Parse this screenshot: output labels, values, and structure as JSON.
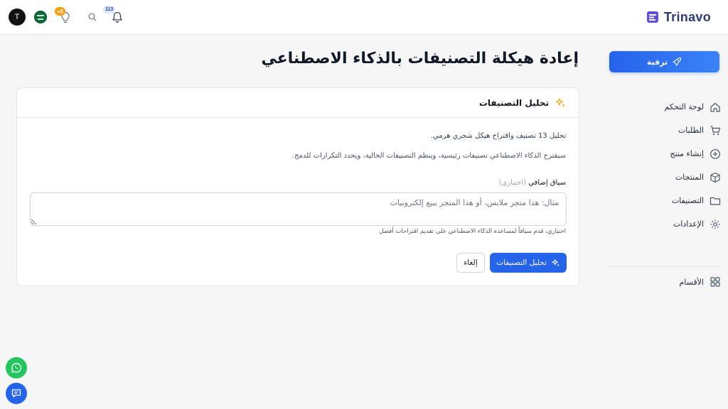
{
  "brand": {
    "name": "Trinavo",
    "color": "#2f3a7a"
  },
  "topbar": {
    "avatar_initial": "T",
    "tips_badge": "+5",
    "notifications_badge": "113"
  },
  "sidebar": {
    "upgrade_label": "ترقية",
    "items": [
      {
        "label": "لوحة التحكم",
        "icon": "home-icon"
      },
      {
        "label": "الطلبات",
        "icon": "cart-icon"
      },
      {
        "label": "إنشاء منتج",
        "icon": "plus-circle-icon"
      },
      {
        "label": "المنتجات",
        "icon": "box-icon"
      },
      {
        "label": "التصنيفات",
        "icon": "folder-icon"
      },
      {
        "label": "الإعدادات",
        "icon": "gear-icon"
      }
    ],
    "sections_label": "الأقسام"
  },
  "main": {
    "title": "إعادة هيكلة التصنيفات بالذكاء الاصطناعي",
    "card": {
      "title": "تحليل التصنيفات",
      "line1": "تحليل 13 تصنيف واقتراح هيكل شجري هرمي.",
      "line2": "سيقترح الذكاء الاصطناعي تصنيفات رئيسية، وينظم التصنيفات الحالية، ويحدد التكرارات للدمج.",
      "context_label": "سياق إضافي",
      "context_optional": "(اختياري)",
      "context_placeholder": "مثال: هذا متجر ملابس، أو هذا المتجر يبيع إلكترونيات",
      "context_value": "",
      "hint": "اختياري، قدم سياقاً لمساعدة الذكاء الاصطناعي على تقديم اقتراحات أفضل",
      "analyze_button": "تحليل التصنيفات",
      "cancel_button": "إلغاء"
    }
  },
  "colors": {
    "primary": "#2563eb",
    "accent": "#f59e0b",
    "whatsapp": "#22c55e"
  }
}
